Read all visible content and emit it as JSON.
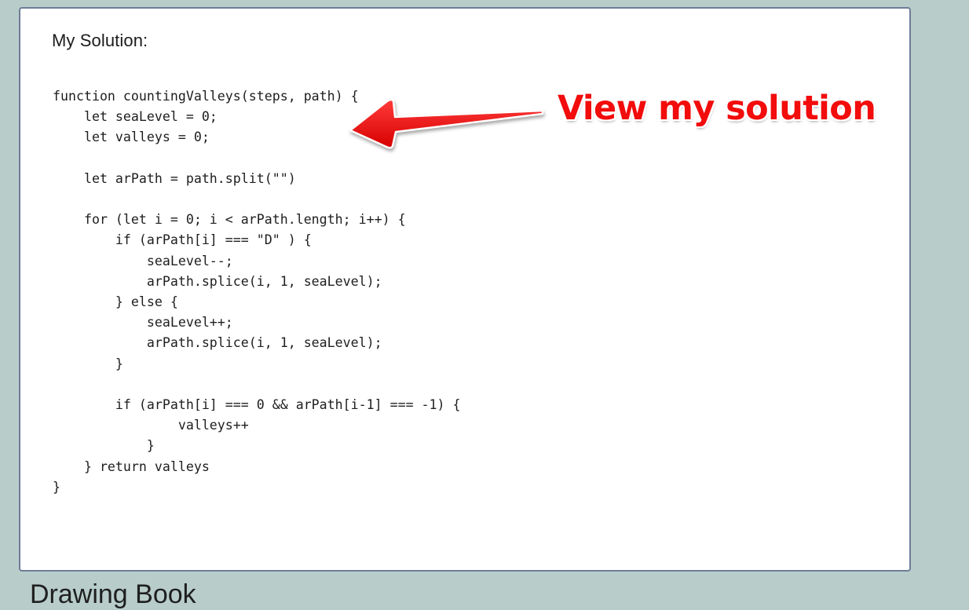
{
  "card": {
    "title": "My Solution:",
    "code": "function countingValleys(steps, path) {\n    let seaLevel = 0;\n    let valleys = 0;\n\n    let arPath = path.split(\"\")\n\n    for (let i = 0; i < arPath.length; i++) {\n        if (arPath[i] === \"D\" ) {\n            seaLevel--;\n            arPath.splice(i, 1, seaLevel);\n        } else {\n            seaLevel++;\n            arPath.splice(i, 1, seaLevel);\n        }\n\n        if (arPath[i] === 0 && arPath[i-1] === -1) {\n                valleys++\n            }\n    } return valleys\n}"
  },
  "annotation": {
    "text": "View my solution",
    "color": "#f20c0c",
    "icon": "red-arrow-icon"
  },
  "next_section": {
    "heading": "Drawing Book"
  },
  "colors": {
    "page_background": "#b8cdca",
    "card_border": "#6f7d98"
  }
}
